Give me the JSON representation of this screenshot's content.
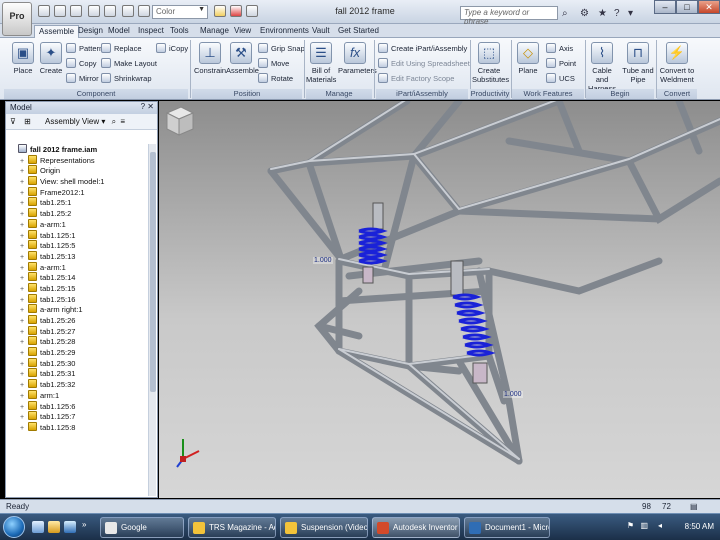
{
  "app": {
    "app_button_label": "Pro",
    "document_title": "fall 2012 frame",
    "color_dropdown": "Color",
    "search_placeholder": "Type a keyword or phrase"
  },
  "tabs": [
    "Assemble",
    "Design",
    "Model",
    "Inspect",
    "Tools",
    "Manage",
    "View",
    "Environments",
    "Vault",
    "Get Started"
  ],
  "active_tab": "Assemble",
  "ribbon": {
    "place": "Place",
    "create": "Create",
    "pattern": "Pattern",
    "copy": "Copy",
    "mirror": "Mirror",
    "replace": "Replace",
    "make_layout": "Make Layout",
    "shrinkwrap": "Shrinkwrap",
    "icopy": "iCopy",
    "constrain": "Constrain",
    "assemble": "Assemble",
    "grip_snap": "Grip Snap",
    "move": "Move",
    "rotate": "Rotate",
    "bom": "Bill of Materials",
    "parameters": "Parameters",
    "create_ipart": "Create iPart/iAssembly",
    "edit_spreadsheet": "Edit Using Spreadsheet",
    "edit_factory_scope": "Edit Factory Scope",
    "create_substitutes": "Create Substitutes",
    "plane": "Plane",
    "axis": "Axis",
    "point": "Point",
    "ucs": "UCS",
    "cable_harness": "Cable and Harness",
    "tube_pipe": "Tube and Pipe",
    "convert_weldment": "Convert to Weldment",
    "panels": {
      "component": "Component",
      "position": "Position",
      "manage": "Manage",
      "ipart": "iPart/iAssembly",
      "productivity": "Productivity",
      "work_features": "Work Features",
      "begin": "Begin",
      "convert": "Convert"
    }
  },
  "browser": {
    "title": "Model",
    "view_dropdown": "Assembly View",
    "items": [
      "fall 2012 frame.iam",
      "Representations",
      "Origin",
      "View: shell model:1",
      "Frame2012:1",
      "tab1.25:1",
      "tab1.25:2",
      "a-arm:1",
      "tab1.125:1",
      "tab1.125:5",
      "tab1.25:13",
      "a-arm:1",
      "tab1.25:14",
      "tab1.25:15",
      "tab1.25:16",
      "a-arm right:1",
      "tab1.25:26",
      "tab1.25:27",
      "tab1.25:28",
      "tab1.25:29",
      "tab1.25:30",
      "tab1.25:31",
      "tab1.25:32",
      "arm:1",
      "tab1.125:6",
      "tab1.125:7",
      "tab1.125:8"
    ]
  },
  "viewport": {
    "dim_label_1": "1.000",
    "dim_label_2": "1.000"
  },
  "statusbar": {
    "text": "Ready",
    "num1": "98",
    "num2": "72"
  },
  "taskbar": {
    "buttons": [
      "Google",
      "TRS Magazine - Adi...",
      "Suspension (Video Tu...",
      "Autodesk Inventor P...",
      "Document1 - Micro..."
    ],
    "active_index": 3,
    "clock": "8:50 AM"
  },
  "colors": {
    "viewport_top": "#8d8d8d",
    "viewport_bottom": "#d6d6d6",
    "frame_tube": "#9aa0a8",
    "spring": "#1a22d8",
    "taskbar": "#1b2f48"
  }
}
